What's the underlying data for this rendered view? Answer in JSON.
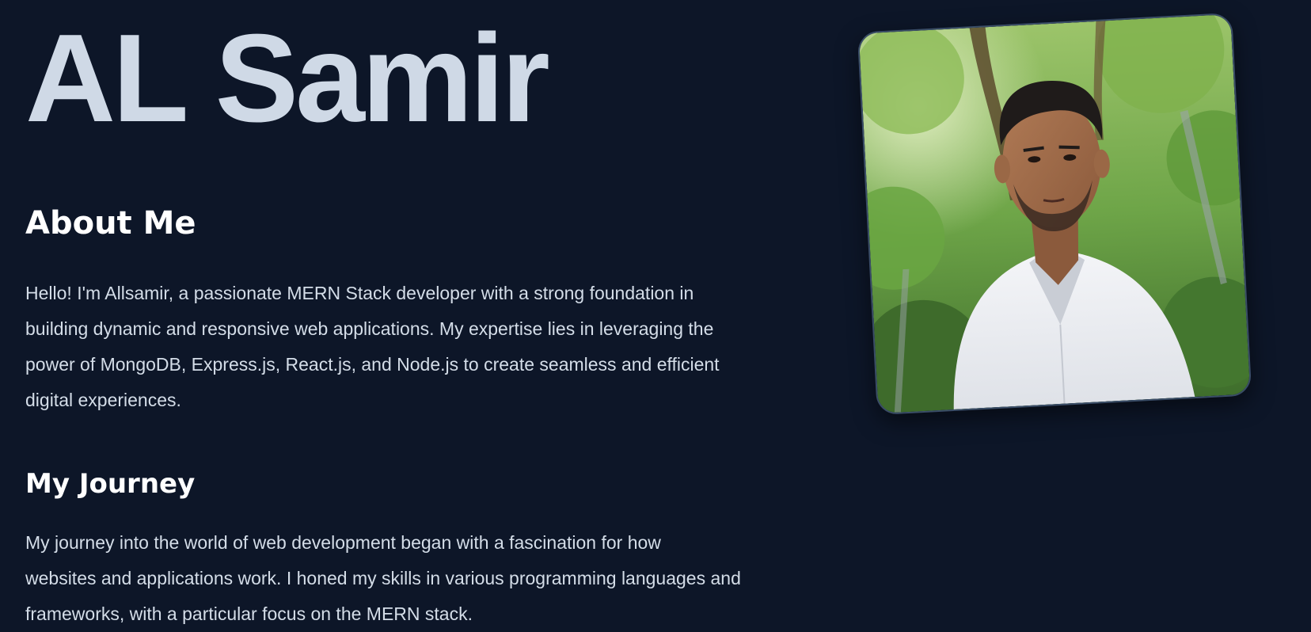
{
  "hero": {
    "name": "AL Samir"
  },
  "about": {
    "heading": "About Me",
    "lines": [
      "Hello! I'm Allsamir, a passionate MERN Stack developer with a strong foundation in",
      "building dynamic and responsive web applications. My expertise lies in leveraging the",
      "power of MongoDB, Express.js, React.js, and Node.js to create seamless and efficient",
      "digital experiences."
    ]
  },
  "journey": {
    "heading": "My Journey",
    "lines": [
      "My journey into the world of web development began with a fascination for how",
      "websites and applications work. I honed my skills in various programming languages and",
      "frameworks, with a particular focus on the MERN stack."
    ]
  },
  "colors": {
    "background": "#0d1628",
    "name_text": "#cfd9e6",
    "heading_text": "#ffffff",
    "body_text": "#d4dde8",
    "photo_border": "#3a4d67"
  }
}
